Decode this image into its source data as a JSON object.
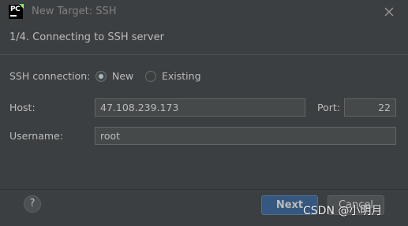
{
  "window": {
    "title": "New Target: SSH",
    "logo_text": "PC",
    "logo_icon": "pycharm-logo-icon",
    "close_icon": "close-icon"
  },
  "step": {
    "title": "1/4. Connecting to SSH server"
  },
  "form": {
    "ssh_connection_label": "SSH connection:",
    "options": [
      {
        "label": "New",
        "selected": true
      },
      {
        "label": "Existing",
        "selected": false
      }
    ],
    "host_label": "Host:",
    "host_value": "47.108.239.173",
    "port_label": "Port:",
    "port_value": "22",
    "username_label": "Username:",
    "username_value": "root"
  },
  "footer": {
    "help_label": "?",
    "next_label": "Next",
    "cancel_label": "Cancel"
  },
  "watermark": {
    "text": "CSDN @小明月"
  },
  "colors": {
    "background": "#3c3f41",
    "primary_button": "#365880",
    "text": "#bbbbbb"
  }
}
